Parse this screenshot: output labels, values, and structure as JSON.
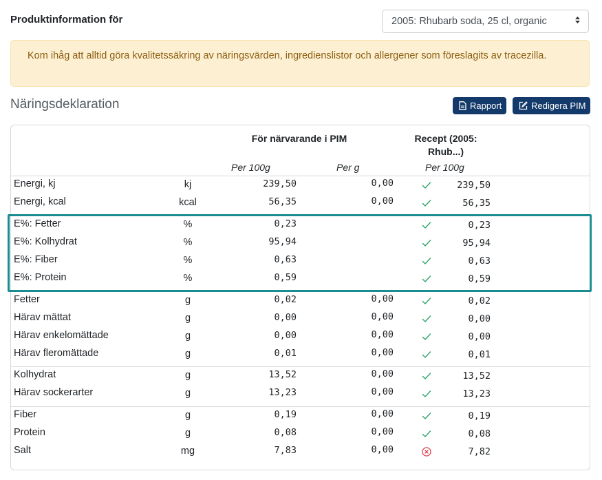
{
  "header": {
    "title": "Produktinformation för",
    "product_select": "2005: Rhubarb soda, 25 cl, organic"
  },
  "alert": {
    "text": "Kom ihåg att alltid göra kvalitetssäkring av näringsvärden, ingredienslistor och allergener som föreslagits av tracezilla."
  },
  "section": {
    "title": "Näringsdeklaration",
    "report_button": "Rapport",
    "edit_button": "Redigera PIM"
  },
  "table": {
    "header_pim": "För närvarande i PIM",
    "header_recipe": "Recept (2005: Rhub...)",
    "sub_per100g": "Per 100g",
    "sub_perg": "Per g",
    "sub_recipe_per100g": "Per 100g",
    "rows": [
      {
        "name": "Energi, kj",
        "unit": "kj",
        "pim": "239,50",
        "perg": "0,00",
        "status": "ok",
        "recipe": "239,50"
      },
      {
        "name": "Energi, kcal",
        "unit": "kcal",
        "pim": "56,35",
        "perg": "0,00",
        "status": "ok",
        "recipe": "56,35"
      },
      {
        "name": "E%: Fetter",
        "unit": "%",
        "pim": "0,23",
        "perg": "",
        "status": "ok",
        "recipe": "0,23"
      },
      {
        "name": "E%: Kolhydrat",
        "unit": "%",
        "pim": "95,94",
        "perg": "",
        "status": "ok",
        "recipe": "95,94"
      },
      {
        "name": "E%: Fiber",
        "unit": "%",
        "pim": "0,63",
        "perg": "",
        "status": "ok",
        "recipe": "0,63"
      },
      {
        "name": "E%: Protein",
        "unit": "%",
        "pim": "0,59",
        "perg": "",
        "status": "ok",
        "recipe": "0,59"
      },
      {
        "name": "Fetter",
        "unit": "g",
        "pim": "0,02",
        "perg": "0,00",
        "status": "ok",
        "recipe": "0,02"
      },
      {
        "name": "Härav mättat",
        "unit": "g",
        "pim": "0,00",
        "perg": "0,00",
        "status": "ok",
        "recipe": "0,00"
      },
      {
        "name": "Härav enkelomättade",
        "unit": "g",
        "pim": "0,00",
        "perg": "0,00",
        "status": "ok",
        "recipe": "0,00"
      },
      {
        "name": "Härav fleromättade",
        "unit": "g",
        "pim": "0,01",
        "perg": "0,00",
        "status": "ok",
        "recipe": "0,01"
      },
      {
        "name": "Kolhydrat",
        "unit": "g",
        "pim": "13,52",
        "perg": "0,00",
        "status": "ok",
        "recipe": "13,52"
      },
      {
        "name": "Härav sockerarter",
        "unit": "g",
        "pim": "13,23",
        "perg": "0,00",
        "status": "ok",
        "recipe": "13,23"
      },
      {
        "name": "Fiber",
        "unit": "g",
        "pim": "0,19",
        "perg": "0,00",
        "status": "ok",
        "recipe": "0,19"
      },
      {
        "name": "Protein",
        "unit": "g",
        "pim": "0,08",
        "perg": "0,00",
        "status": "ok",
        "recipe": "0,08"
      },
      {
        "name": "Salt",
        "unit": "mg",
        "pim": "7,83",
        "perg": "0,00",
        "status": "mismatch",
        "recipe": "7,82"
      }
    ]
  },
  "colors": {
    "ok_check": "#2ea36a",
    "mismatch": "#dc3545",
    "highlight_border": "#1b8d92",
    "button_bg": "#133a6a"
  }
}
